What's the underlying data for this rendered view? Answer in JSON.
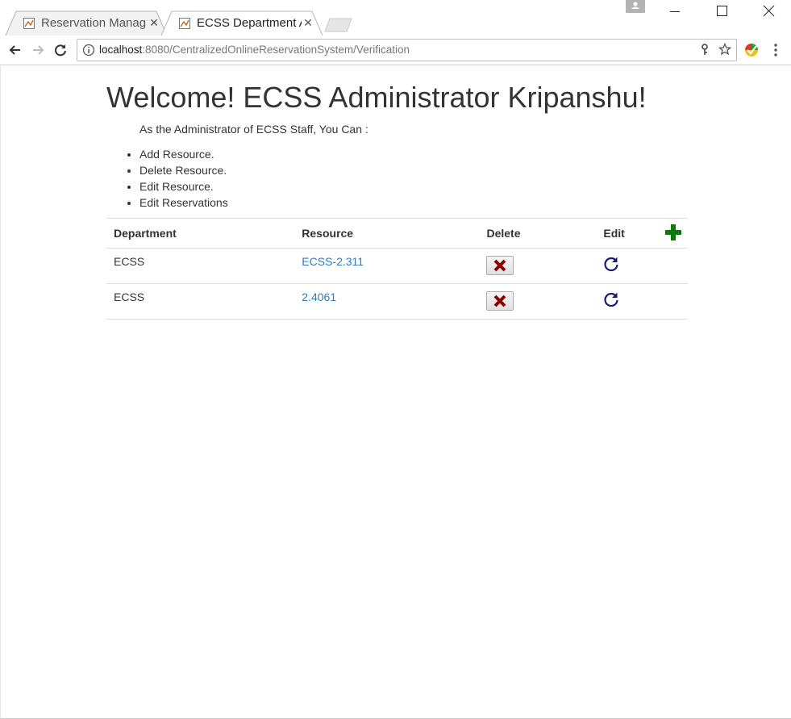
{
  "browser": {
    "tabs": [
      {
        "title": "Reservation Manage",
        "active": false
      },
      {
        "title": "ECSS Department A",
        "active": true
      }
    ],
    "url_host": "localhost",
    "url_rest": ":8080/CentralizedOnlineReservationSystem/Verification"
  },
  "page": {
    "heading": "Welcome! ECSS Administrator Kripanshu!",
    "intro": "As the Administrator of ECSS Staff, You Can :",
    "abilities": [
      "Add Resource.",
      "Delete Resource.",
      "Edit Resource.",
      "Edit Reservations"
    ],
    "table": {
      "headers": [
        "Department",
        "Resource",
        "Delete",
        "Edit"
      ],
      "rows": [
        {
          "department": "ECSS",
          "resource": "ECSS-2.311"
        },
        {
          "department": "ECSS",
          "resource": "2.4061"
        }
      ]
    }
  },
  "colors": {
    "link": "#337ab7",
    "add_icon": "#0a7a0a",
    "delete_icon": "#8b0000",
    "edit_icon": "#1a1a6e"
  }
}
